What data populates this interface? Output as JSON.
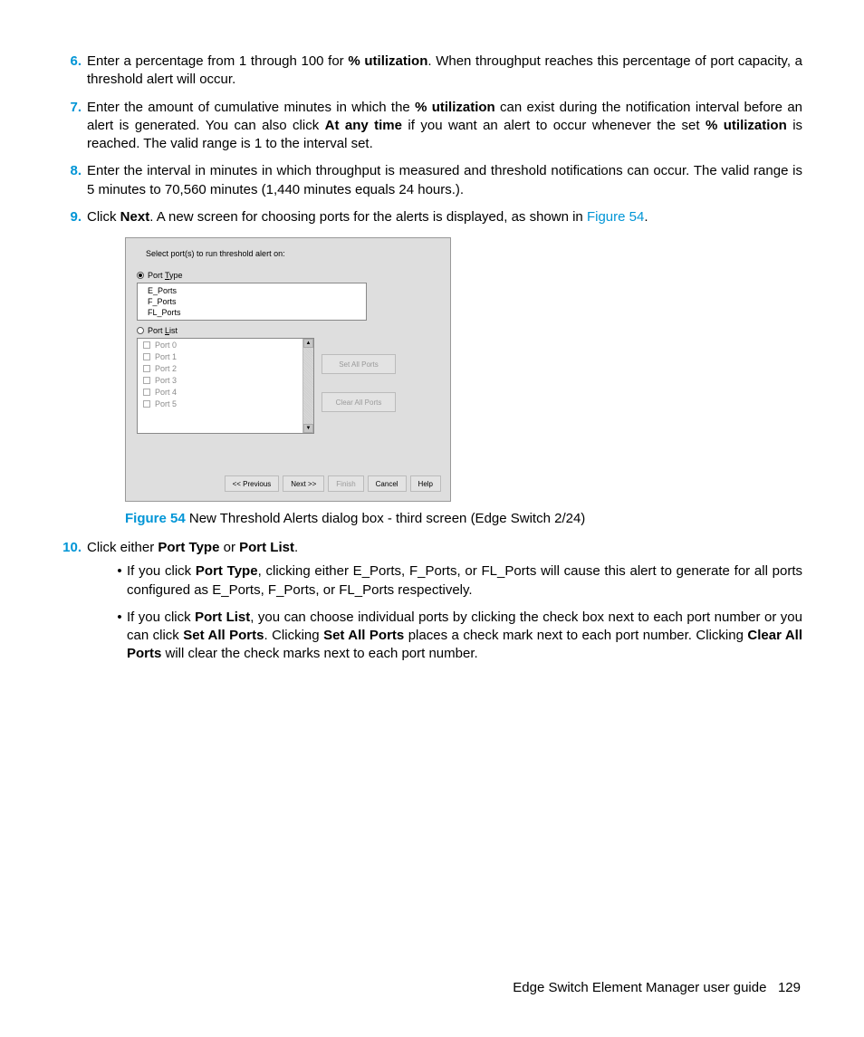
{
  "steps": {
    "s6": {
      "num": "6.",
      "t1": "Enter a percentage from 1 through 100 for ",
      "b1": "% utilization",
      "t2": ". When throughput reaches this percentage of port capacity, a threshold alert will occur."
    },
    "s7": {
      "num": "7.",
      "t1": "Enter the amount of cumulative minutes in which the ",
      "b1": "% utilization",
      "t2": " can exist during the notification interval before an alert is generated. You can also click ",
      "b2": "At any time",
      "t3": " if you want an alert to occur whenever the set ",
      "b3": "% utilization",
      "t4": " is reached. The valid range is 1 to the interval set."
    },
    "s8": {
      "num": "8.",
      "t1": "Enter the interval in minutes in which throughput is measured and threshold notifications can occur. The valid range is 5 minutes to 70,560 minutes (1,440 minutes equals 24 hours.)."
    },
    "s9": {
      "num": "9.",
      "t1": "Click ",
      "b1": "Next",
      "t2": ". A new screen for choosing ports for the alerts is displayed, as shown in ",
      "link": "Figure 54",
      "t3": "."
    },
    "s10": {
      "num": "10.",
      "t1": "Click either ",
      "b1": "Port Type",
      "t2": " or ",
      "b2": "Port List",
      "t3": "."
    }
  },
  "subbullets": {
    "a": {
      "t1": "If you click ",
      "b1": "Port Type",
      "t2": ", clicking either E_Ports, F_Ports, or FL_Ports will cause this alert to generate for all ports configured as E_Ports, F_Ports, or FL_Ports respectively."
    },
    "b": {
      "t1": "If you click ",
      "b1": "Port List",
      "t2": ", you can choose individual ports by clicking the check box next to each port number or you can click ",
      "b2": "Set All Ports",
      "t3": ". Clicking ",
      "b3": "Set All Ports",
      "t4": " places a check mark next to each port number. Clicking ",
      "b4": "Clear All Ports",
      "t5": " will clear the check marks next to each port number."
    }
  },
  "figure": {
    "label": "Figure 54",
    "caption": "  New Threshold Alerts dialog box - third screen (Edge Switch 2/24)"
  },
  "dialog": {
    "instruction": "Select port(s) to run threshold alert on:",
    "port_type_label": "Port Type",
    "port_type_options": [
      "E_Ports",
      "F_Ports",
      "FL_Ports"
    ],
    "port_list_label": "Port List",
    "ports": [
      "Port 0",
      "Port 1",
      "Port 2",
      "Port 3",
      "Port 4",
      "Port 5"
    ],
    "set_all": "Set All Ports",
    "clear_all": "Clear All Ports",
    "buttons": {
      "prev": "<< Previous",
      "next": "Next >>",
      "finish": "Finish",
      "cancel": "Cancel",
      "help": "Help"
    }
  },
  "footer": {
    "text": "Edge Switch Element Manager user guide",
    "page": "129"
  }
}
